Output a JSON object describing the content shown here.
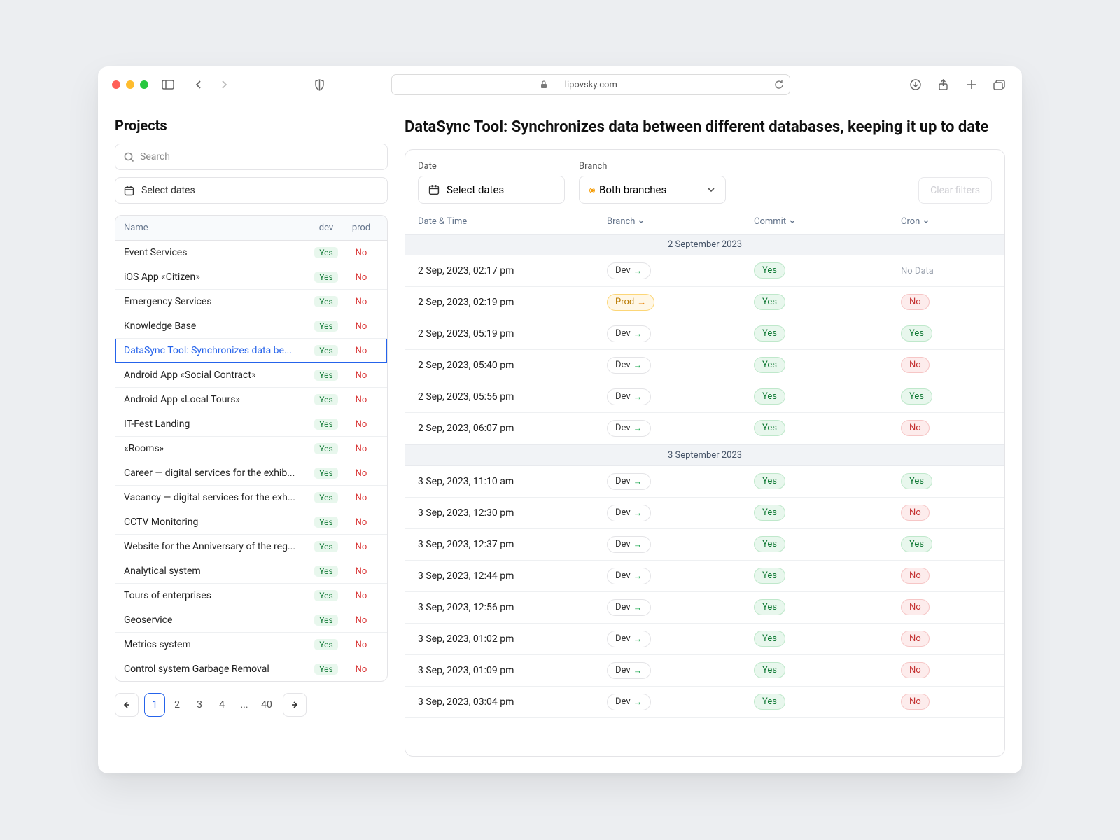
{
  "browser": {
    "url_display": "lipovsky.com"
  },
  "sidebar": {
    "title": "Projects",
    "search_placeholder": "Search",
    "date_label": "Select dates",
    "columns": {
      "name": "Name",
      "dev": "dev",
      "prod": "prod"
    },
    "projects": [
      {
        "name": "Event Services",
        "dev": "Yes",
        "prod": "No"
      },
      {
        "name": "iOS App «Citizen»",
        "dev": "Yes",
        "prod": "No"
      },
      {
        "name": "Emergency Services",
        "dev": "Yes",
        "prod": "No"
      },
      {
        "name": "Knowledge Base",
        "dev": "Yes",
        "prod": "No"
      },
      {
        "name": "DataSync Tool: Synchronizes data be...",
        "dev": "Yes",
        "prod": "No",
        "selected": true
      },
      {
        "name": "Android App «Social Contract»",
        "dev": "Yes",
        "prod": "No"
      },
      {
        "name": "Android App «Local Tours»",
        "dev": "Yes",
        "prod": "No"
      },
      {
        "name": "IT-Fest Landing",
        "dev": "Yes",
        "prod": "No"
      },
      {
        "name": "«Rooms»",
        "dev": "Yes",
        "prod": "No"
      },
      {
        "name": "Career — digital services for the exhib...",
        "dev": "Yes",
        "prod": "No"
      },
      {
        "name": "Vacancy — digital services for the exh...",
        "dev": "Yes",
        "prod": "No"
      },
      {
        "name": "CCTV Monitoring",
        "dev": "Yes",
        "prod": "No"
      },
      {
        "name": "Website for the Anniversary of the reg...",
        "dev": "Yes",
        "prod": "No"
      },
      {
        "name": "Analytical system",
        "dev": "Yes",
        "prod": "No"
      },
      {
        "name": "Tours of enterprises",
        "dev": "Yes",
        "prod": "No"
      },
      {
        "name": "Geoservice",
        "dev": "Yes",
        "prod": "No"
      },
      {
        "name": "Metrics system",
        "dev": "Yes",
        "prod": "No"
      },
      {
        "name": "Control system Garbage Removal",
        "dev": "Yes",
        "prod": "No"
      }
    ],
    "pagination": {
      "pages": [
        "1",
        "2",
        "3",
        "4",
        "...",
        "40"
      ],
      "active": "1"
    }
  },
  "main": {
    "title": "DataSync Tool: Synchronizes data between different databases, keeping it up to date",
    "filters": {
      "date_label": "Date",
      "date_value": "Select dates",
      "branch_label": "Branch",
      "branch_value": "Both branches",
      "clear": "Clear filters"
    },
    "log_header": {
      "date": "Date & Time",
      "branch": "Branch",
      "commit": "Commit",
      "cron": "Cron"
    },
    "groups": [
      {
        "label": "2 September 2023",
        "rows": [
          {
            "dt": "2 Sep, 2023, 02:17 pm",
            "branch": "Dev",
            "commit": "Yes",
            "cron": "NoData"
          },
          {
            "dt": "2 Sep, 2023, 02:19 pm",
            "branch": "Prod",
            "commit": "Yes",
            "cron": "No"
          },
          {
            "dt": "2 Sep, 2023, 05:19 pm",
            "branch": "Dev",
            "commit": "Yes",
            "cron": "Yes"
          },
          {
            "dt": "2 Sep, 2023, 05:40 pm",
            "branch": "Dev",
            "commit": "Yes",
            "cron": "No"
          },
          {
            "dt": "2 Sep, 2023, 05:56 pm",
            "branch": "Dev",
            "commit": "Yes",
            "cron": "Yes"
          },
          {
            "dt": "2 Sep, 2023, 06:07 pm",
            "branch": "Dev",
            "commit": "Yes",
            "cron": "No"
          }
        ]
      },
      {
        "label": "3 September 2023",
        "rows": [
          {
            "dt": "3 Sep, 2023, 11:10 am",
            "branch": "Dev",
            "commit": "Yes",
            "cron": "Yes"
          },
          {
            "dt": "3 Sep, 2023, 12:30 pm",
            "branch": "Dev",
            "commit": "Yes",
            "cron": "No"
          },
          {
            "dt": "3 Sep, 2023, 12:37 pm",
            "branch": "Dev",
            "commit": "Yes",
            "cron": "Yes"
          },
          {
            "dt": "3 Sep, 2023, 12:44 pm",
            "branch": "Dev",
            "commit": "Yes",
            "cron": "No"
          },
          {
            "dt": "3 Sep, 2023, 12:56 pm",
            "branch": "Dev",
            "commit": "Yes",
            "cron": "No"
          },
          {
            "dt": "3 Sep, 2023, 01:02 pm",
            "branch": "Dev",
            "commit": "Yes",
            "cron": "No"
          },
          {
            "dt": "3 Sep, 2023, 01:09 pm",
            "branch": "Dev",
            "commit": "Yes",
            "cron": "No"
          },
          {
            "dt": "3 Sep, 2023, 03:04 pm",
            "branch": "Dev",
            "commit": "Yes",
            "cron": "No"
          }
        ]
      }
    ],
    "strings": {
      "no_data": "No Data",
      "dev": "Dev",
      "prod": "Prod",
      "yes": "Yes",
      "no": "No"
    }
  }
}
